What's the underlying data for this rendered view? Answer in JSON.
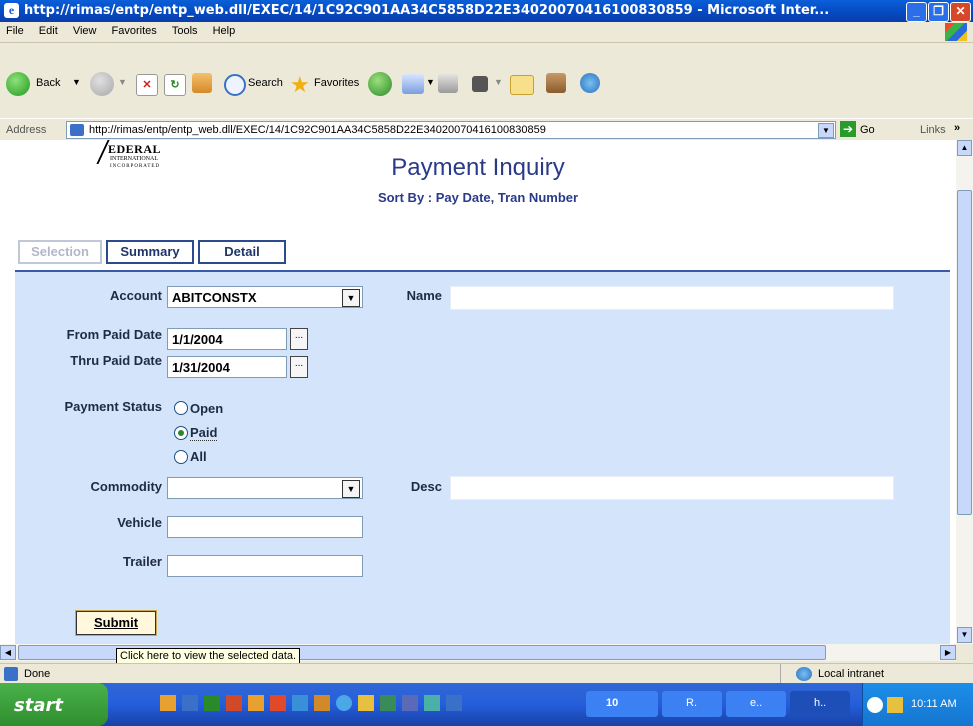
{
  "window": {
    "title": "http://rimas/entp/entp_web.dll/EXEC/14/1C92C901AA34C5858D22E34020070416100830859 - Microsoft Inter..."
  },
  "menu": [
    "File",
    "Edit",
    "View",
    "Favorites",
    "Tools",
    "Help"
  ],
  "toolbar": {
    "back": "Back",
    "search": "Search",
    "favorites": "Favorites"
  },
  "address": {
    "label": "Address",
    "url": "http://rimas/entp/entp_web.dll/EXEC/14/1C92C901AA34C5858D22E34020070416100830859",
    "go": "Go",
    "links": "Links"
  },
  "page": {
    "logo_text": "EDERAL",
    "logo_sub1": "INTERNATIONAL",
    "logo_sub2": "INCORPORATED",
    "title": "Payment Inquiry",
    "subtitle": "Sort By : Pay Date, Tran Number",
    "tabs": [
      "Selection",
      "Summary",
      "Detail"
    ],
    "form": {
      "account_label": "Account",
      "account_value": "ABITCONSTX",
      "name_label": "Name",
      "name_value": "",
      "from_label": "From Paid Date",
      "from_value": "1/1/2004",
      "thru_label": "Thru Paid Date",
      "thru_value": "1/31/2004",
      "date_btn": "...",
      "status_label": "Payment Status",
      "status_options": [
        "Open",
        "Paid",
        "All"
      ],
      "status_selected": "Paid",
      "commodity_label": "Commodity",
      "commodity_value": "",
      "desc_label": "Desc",
      "desc_value": "",
      "vehicle_label": "Vehicle",
      "vehicle_value": "",
      "trailer_label": "Trailer",
      "trailer_value": "",
      "submit": "Submit",
      "tooltip": "Click here to view the selected data."
    }
  },
  "status": {
    "text": "Done",
    "zone": "Local intranet"
  },
  "taskbar": {
    "start": "start",
    "clock": "10:11 AM",
    "tasks": [
      "10",
      "R.",
      "e..",
      "h.."
    ]
  }
}
